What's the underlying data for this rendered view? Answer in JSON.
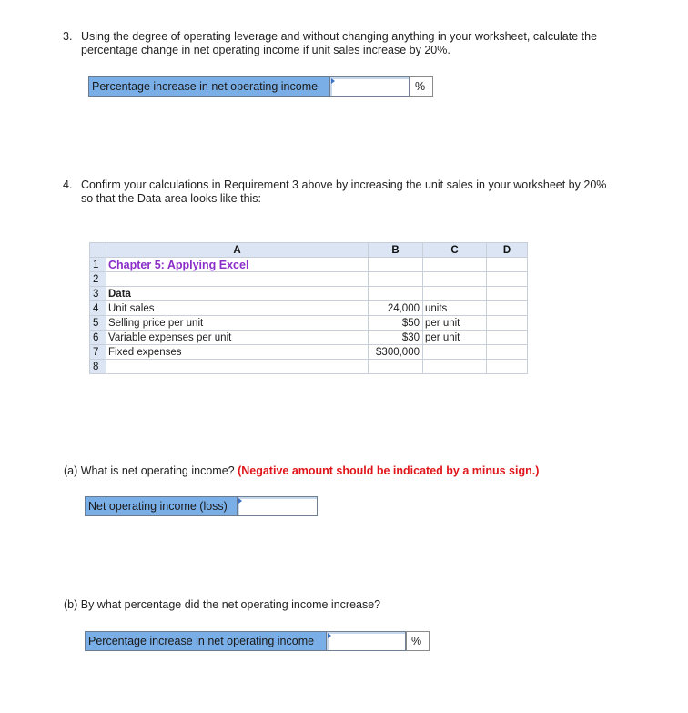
{
  "q3": {
    "number": "3.",
    "text_line1": "Using the degree of operating leverage and without changing anything in your worksheet, calculate the",
    "text_line2": "percentage change in net operating income if unit sales increase by 20%.",
    "answer_label": "Percentage increase in net operating income",
    "answer_value": "",
    "answer_unit": "%"
  },
  "q4": {
    "number": "4.",
    "text_line1": "Confirm your calculations in Requirement 3 above by increasing the unit sales in your worksheet by 20%",
    "text_line2": "so that the Data area looks like this:"
  },
  "sheet": {
    "columns": [
      "A",
      "B",
      "C",
      "D"
    ],
    "rows": [
      {
        "n": "1",
        "a": "Chapter 5: Applying Excel",
        "b": "",
        "c": "",
        "d": ""
      },
      {
        "n": "2",
        "a": "",
        "b": "",
        "c": "",
        "d": ""
      },
      {
        "n": "3",
        "a": "Data",
        "b": "",
        "c": "",
        "d": ""
      },
      {
        "n": "4",
        "a": "Unit sales",
        "b": "24,000",
        "c": "units",
        "d": ""
      },
      {
        "n": "5",
        "a": "Selling price per unit",
        "b": "$50",
        "c": "per unit",
        "d": ""
      },
      {
        "n": "6",
        "a": "Variable expenses per unit",
        "b": "$30",
        "c": "per unit",
        "d": ""
      },
      {
        "n": "7",
        "a": "Fixed expenses",
        "b": "$300,000",
        "c": "",
        "d": ""
      },
      {
        "n": "8",
        "a": "",
        "b": "",
        "c": "",
        "d": ""
      }
    ]
  },
  "qa": {
    "prefix": "(a) What is net operating income?",
    "note": "(Negative amount should be indicated by a minus sign.)",
    "answer_label": "Net operating income (loss)",
    "answer_value": ""
  },
  "qb": {
    "prefix": "(b) By what percentage did the net operating income increase?",
    "answer_label": "Percentage increase in net operating income",
    "answer_value": "",
    "answer_unit": "%"
  },
  "colors": {
    "label_bg": "#7aaee6",
    "title_purple": "#8b2fc9",
    "warning_red": "#e0151b",
    "sheet_header_bg": "#dbe5f3"
  }
}
